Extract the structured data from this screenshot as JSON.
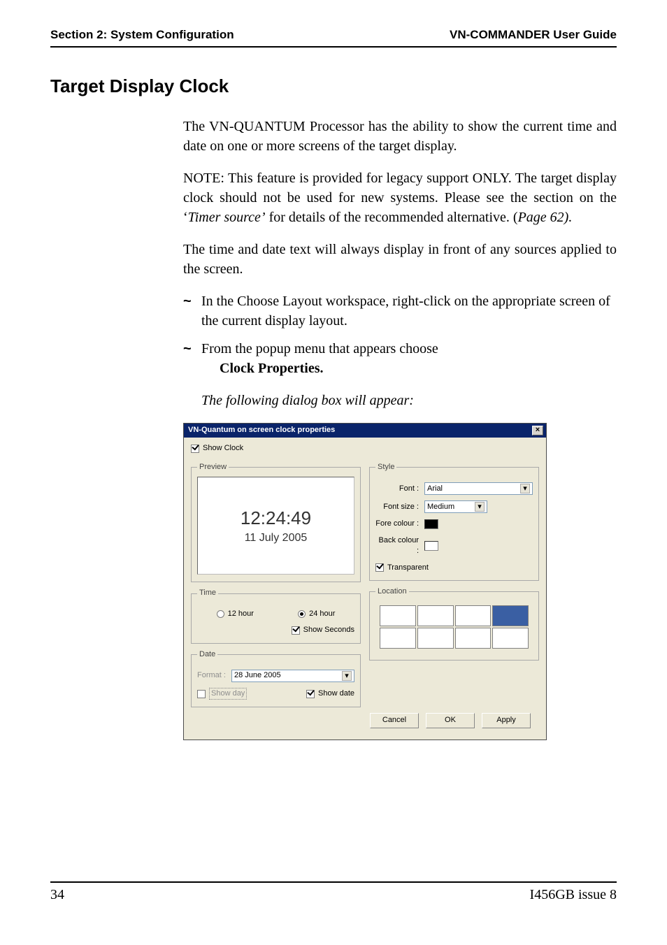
{
  "header": {
    "left": "Section 2: System Configuration",
    "right": "VN-COMMANDER User Guide"
  },
  "title": "Target Display Clock",
  "paras": {
    "p1": "The VN-QUANTUM Processor has the ability to show the current time and date on one or more screens of the target display.",
    "p2a": "NOTE: This feature is provided for legacy support ONLY. The target display clock should not be used for new systems. Please see the section on the ‘",
    "p2i": "Timer source’",
    "p2b": " for details of the recommended alternative. (",
    "p2c": "Page 62).",
    "p3": "The time and date text will always display in front of any sources applied to the screen.",
    "b1": "In the Choose Layout workspace, right-click on the appropriate screen of the current display layout.",
    "b2a": "From the popup menu that appears choose ",
    "b2b": "Clock Properties.",
    "caption": "The following dialog box will appear:"
  },
  "dialog": {
    "title": "VN-Quantum on screen clock properties",
    "show_clock_label": "Show Clock",
    "preview": {
      "legend": "Preview",
      "time": "12:24:49",
      "date": "11 July 2005"
    },
    "time": {
      "legend": "Time",
      "h12": "12 hour",
      "h24": "24 hour",
      "show_seconds": "Show Seconds"
    },
    "date": {
      "legend": "Date",
      "format_label": "Format :",
      "format_value": "28 June 2005",
      "show_day": "Show day",
      "show_date": "Show date"
    },
    "style": {
      "legend": "Style",
      "font_label": "Font :",
      "font_value": "Arial",
      "fontsize_label": "Font size :",
      "fontsize_value": "Medium",
      "fore_label": "Fore colour :",
      "fore_hex": "#000000",
      "back_label": "Back colour :",
      "back_hex": "#ffffff",
      "transparent": "Transparent"
    },
    "location": {
      "legend": "Location"
    },
    "buttons": {
      "cancel": "Cancel",
      "ok": "OK",
      "apply": "Apply"
    }
  },
  "footer": {
    "page": "34",
    "issue": "I456GB issue 8"
  }
}
